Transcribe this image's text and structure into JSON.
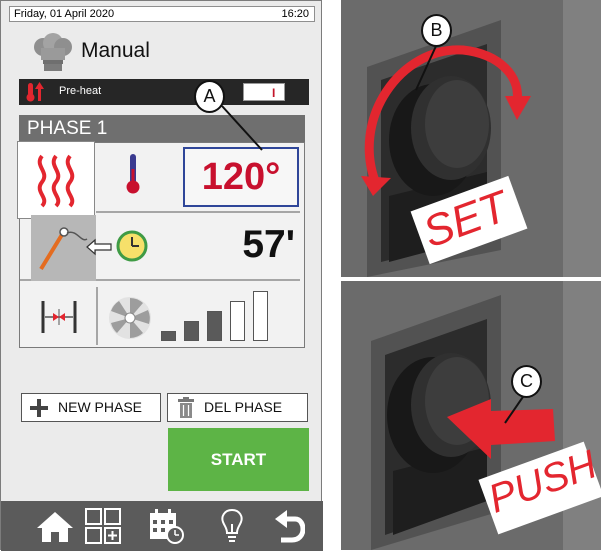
{
  "status_bar": {
    "date": "Friday, 01 April 2020",
    "time": "16:20"
  },
  "mode": {
    "title": "Manual"
  },
  "preheat": {
    "label": "Pre-heat",
    "switch_state": "I"
  },
  "phase": {
    "title": "PHASE 1",
    "temperature": "120°",
    "time": "57'",
    "fan_speed_level": 3,
    "fan_speed_max": 5
  },
  "buttons": {
    "new_phase": "NEW PHASE",
    "del_phase": "DEL PHASE",
    "start": "START"
  },
  "nav": [
    "home-icon",
    "programs-grid-icon",
    "calendar-icon",
    "lightbulb-icon",
    "back-icon"
  ],
  "callouts": {
    "a": "A",
    "b": "B",
    "c": "C"
  },
  "knob_labels": {
    "set": "SET",
    "push": "PUSH"
  },
  "colors": {
    "accent_red": "#e3262f",
    "temperature_red": "#c8102e",
    "temperature_border": "#2f4699",
    "start_green": "#5db446",
    "clock_yellow": "#f6e06a",
    "clock_green": "#3f9b45",
    "nav_bar": "#5b5b5b"
  }
}
